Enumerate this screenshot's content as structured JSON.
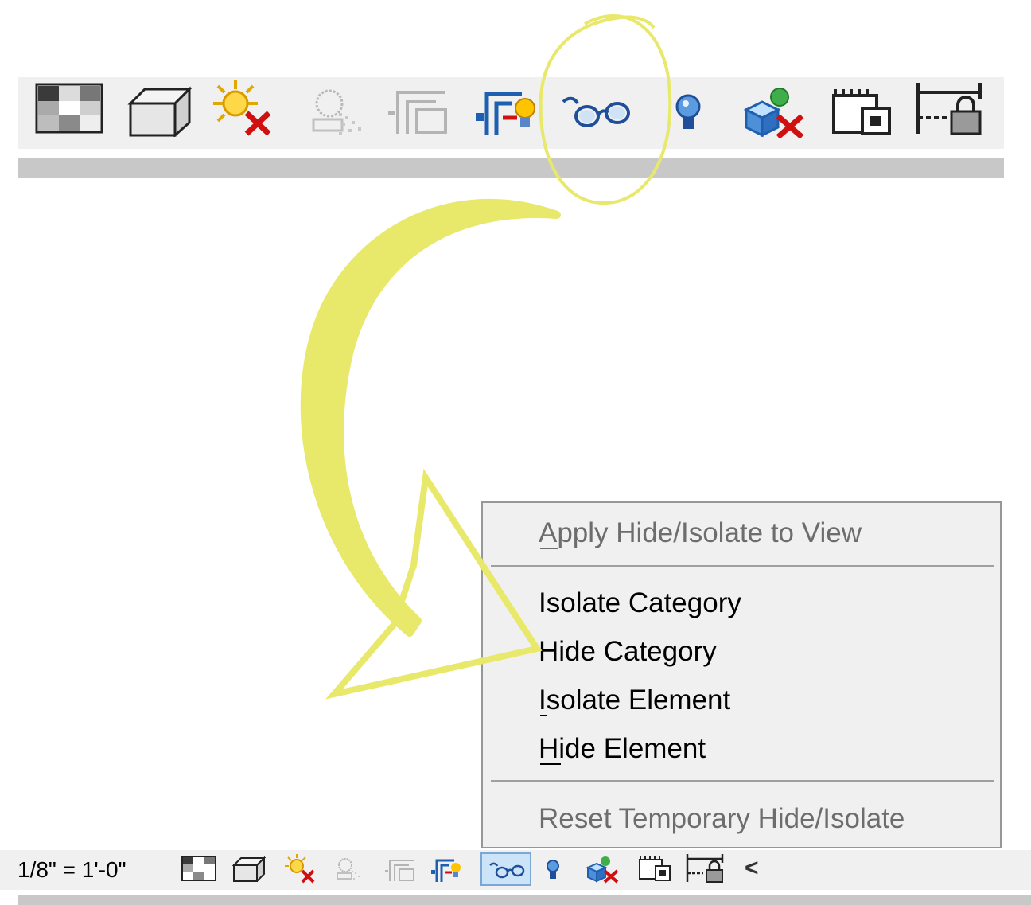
{
  "menu": {
    "items": [
      {
        "label": "Apply Hide/Isolate to View",
        "enabled": false
      },
      {
        "label": "Isolate Category",
        "enabled": true
      },
      {
        "label": "Hide Category",
        "enabled": true
      },
      {
        "label": "Isolate Element",
        "enabled": true
      },
      {
        "label": "Hide Element",
        "enabled": true
      },
      {
        "label": "Reset Temporary Hide/Isolate",
        "enabled": false
      }
    ]
  },
  "status_bar": {
    "scale": "1/8\" = 1'-0\"",
    "collapse_glyph": "<"
  },
  "toolbar_icons": [
    "detail-level-icon",
    "visual-style-icon",
    "sun-path-off-icon",
    "shadows-icon",
    "crop-view-icon",
    "show-crop-region-icon",
    "temporary-hide-isolate-icon",
    "reveal-hidden-elements-icon",
    "worksharing-display-icon",
    "lock-3d-view-icon",
    "temporary-view-properties-icon"
  ],
  "colors": {
    "highlighter": "#e8e86a",
    "toolbar_bg": "#f0f0f0",
    "active_button": "#cce4f7",
    "disabled_text": "#6d6d6d"
  }
}
